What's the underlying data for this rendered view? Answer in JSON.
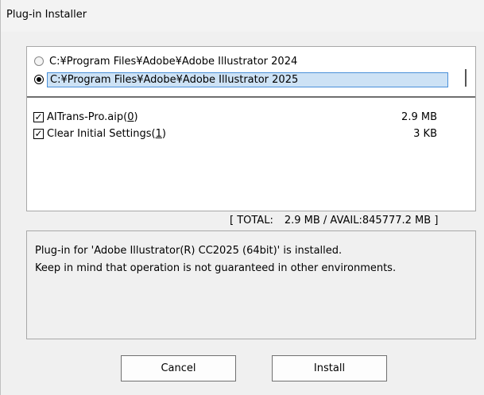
{
  "window": {
    "title": "Plug-in Installer"
  },
  "install_paths": [
    {
      "label": "C:¥Program Files¥Adobe¥Adobe Illustrator 2024",
      "selected": false
    },
    {
      "label": "C:¥Program Files¥Adobe¥Adobe Illustrator 2025",
      "selected": true
    }
  ],
  "files": [
    {
      "name": "AITrans-Pro.aip(",
      "index": "0",
      "suffix": ")",
      "size": "2.9 MB",
      "checked": true
    },
    {
      "name": "Clear Initial Settings(",
      "index": "1",
      "suffix": ")",
      "size": "3 KB",
      "checked": true
    }
  ],
  "summary": {
    "prefix": "[ TOTAL:",
    "value": "2.9 MB / AVAIL:845777.2 MB ]"
  },
  "message": {
    "line1": "Plug-in for 'Adobe Illustrator(R) CC2025 (64bit)' is installed.",
    "line2": "Keep in mind that operation is not guaranteed in other environments."
  },
  "buttons": {
    "cancel": "Cancel",
    "install": "Install"
  },
  "icons": {
    "check": "✓"
  }
}
